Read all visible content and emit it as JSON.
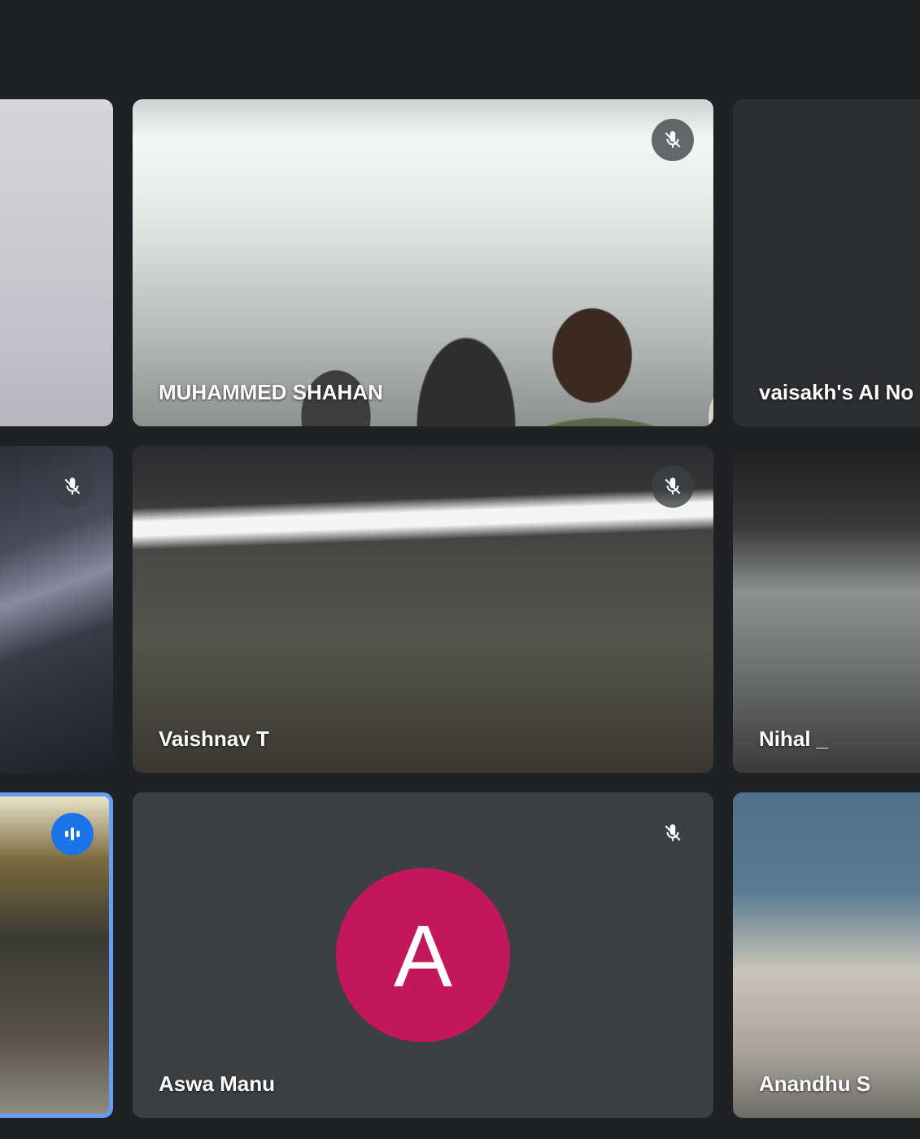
{
  "colors": {
    "page_background": "#202124",
    "tile_background": "#3c4043",
    "active_speaker_border": "#669df6",
    "speaking_indicator": "#1a73e8",
    "avatar_aswa": "#c2185b"
  },
  "participants": [
    {
      "name": "",
      "muted": false
    },
    {
      "name": "MUHAMMED SHAHAN",
      "muted": true
    },
    {
      "name": "vaisakh's AI No",
      "muted": false
    },
    {
      "name": "",
      "muted": true
    },
    {
      "name": "Vaishnav T",
      "muted": true
    },
    {
      "name": "Nihal _",
      "muted": false
    },
    {
      "name": "",
      "muted": false,
      "speaking": true
    },
    {
      "name": "Aswa Manu",
      "muted": true,
      "avatar_letter": "A"
    },
    {
      "name": "Anandhu S",
      "muted": false
    }
  ],
  "icons": {
    "muted": "mic-off-icon",
    "speaking": "audio-level-icon"
  }
}
